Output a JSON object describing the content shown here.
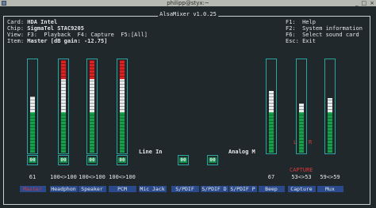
{
  "window": {
    "title": "philipp@styx:~",
    "buttons": [
      "_",
      "□",
      "×"
    ]
  },
  "app": {
    "title": "AlsaMixer v1.0.25"
  },
  "info": {
    "card_key": "Card:",
    "card_val": "HDA Intel",
    "chip_key": "Chip:",
    "chip_val": "SigmaTel STAC9205",
    "view_key": "View:",
    "view_val": "F3:  Playback  F4: Capture  F5:[All]",
    "item_key": "Item:",
    "item_val": "Master [dB gain: -12.75]"
  },
  "help": {
    "f1": "F1:  Help",
    "f2": "F2:  System information",
    "f6": "F6:  Select sound card",
    "esc": "Esc: Exit"
  },
  "mute_text": "00",
  "analog_labels": {
    "line_in": "Line In",
    "analog_m": "Analog M"
  },
  "capture_flags": {
    "l": "L",
    "r": "R",
    "capture": "CAPTURE"
  },
  "colors": {
    "green": "#12a34a",
    "white": "#e8ecec",
    "red": "#e02020",
    "frame": "#2aa6a0",
    "label_bg": "#2a4a8c"
  },
  "channels": [
    {
      "name": "Master",
      "value": "61",
      "level": 0.61,
      "selected": true
    },
    {
      "name": "Headphon",
      "value": "100<>100",
      "level": 1.0
    },
    {
      "name": "Speaker",
      "value": "100<>100",
      "level": 1.0
    },
    {
      "name": "PCM",
      "value": "100<>100",
      "level": 1.0
    },
    {
      "name": "Mic Jack",
      "value": ""
    },
    {
      "name": "S/PDIF",
      "value": ""
    },
    {
      "name": "S/PDIF D",
      "value": ""
    },
    {
      "name": "S/PDIF P",
      "value": ""
    },
    {
      "name": "Beep",
      "value": "67",
      "level": 0.67
    },
    {
      "name": "Capture",
      "value": "53<>53",
      "level": 0.53
    },
    {
      "name": "Mux",
      "value": "59<>59",
      "level": 0.59
    }
  ]
}
